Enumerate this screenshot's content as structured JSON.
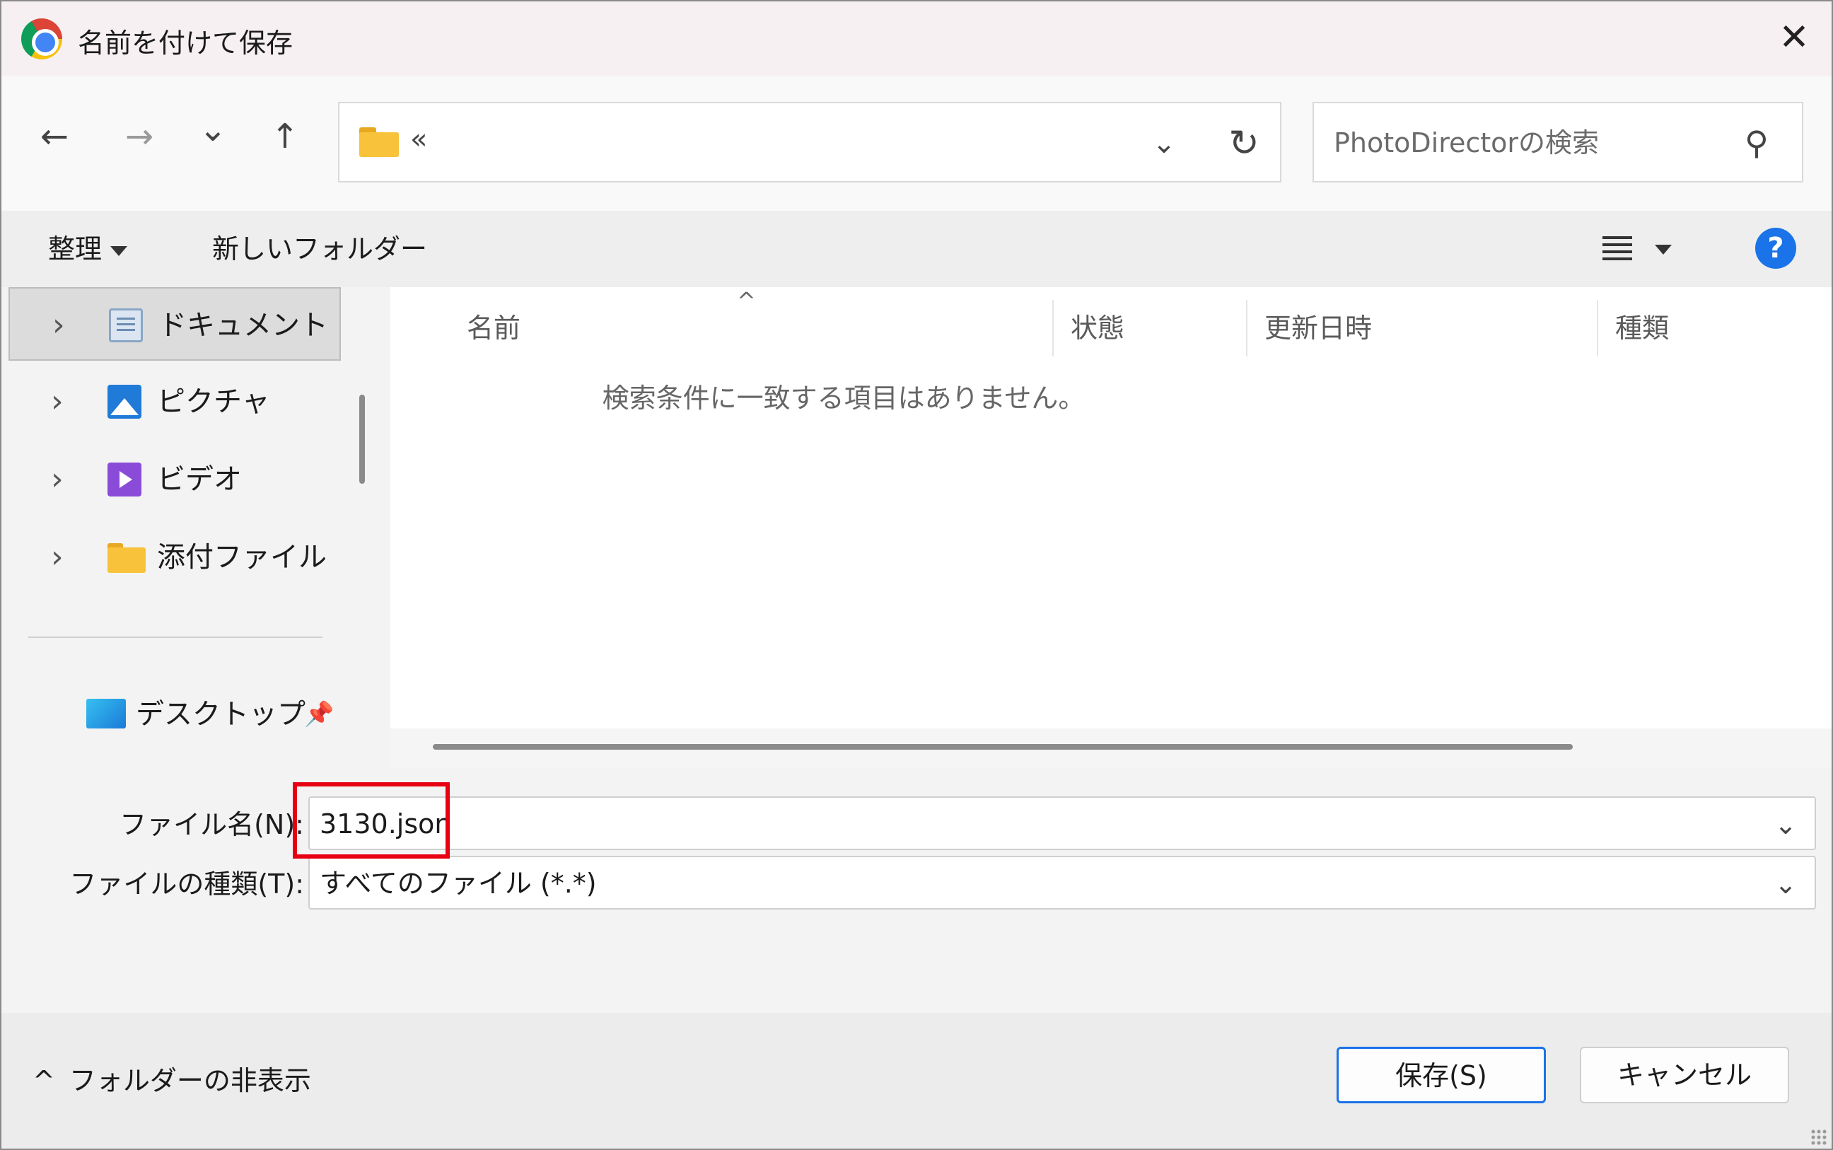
{
  "window": {
    "title": "名前を付けて保存",
    "close_glyph": "✕"
  },
  "address_bar": {
    "back_glyph": "←",
    "forward_glyph": "→",
    "recent_glyph": "⌄",
    "up_glyph": "↑",
    "breadcrumb": "«",
    "dropdown_glyph": "⌄",
    "refresh_glyph": "↻"
  },
  "search": {
    "placeholder": "PhotoDirectorの検索",
    "icon_glyph": "⚲"
  },
  "toolbar": {
    "organize_label": "整理",
    "new_folder_label": "新しいフォルダー",
    "help_label": "?"
  },
  "nav_pane": {
    "items": [
      {
        "label": "ドキュメント",
        "icon": "document-icon",
        "selected": true
      },
      {
        "label": "ピクチャ",
        "icon": "picture-icon",
        "selected": false
      },
      {
        "label": "ビデオ",
        "icon": "video-icon",
        "selected": false
      },
      {
        "label": "添付ファイル",
        "icon": "folder-icon",
        "selected": false
      }
    ],
    "pinned": [
      {
        "label": "デスクトップ",
        "icon": "desktop-icon",
        "pin_glyph": "📌"
      }
    ],
    "chevron_glyph": "›"
  },
  "file_list": {
    "columns": [
      "名前",
      "状態",
      "更新日時",
      "種類"
    ],
    "sort_glyph": "^",
    "empty_message": "検索条件に一致する項目はありません。"
  },
  "save_fields": {
    "filename_label": "ファイル名(N):",
    "filename_value": "3130.json",
    "filetype_label": "ファイルの種類(T):",
    "filetype_value": "すべてのファイル (*.*)",
    "dropdown_glyph": "⌄"
  },
  "footer": {
    "hide_folders_glyph": "^",
    "hide_folders_label": "フォルダーの非表示",
    "save_button": "保存(S)",
    "cancel_button": "キャンセル"
  },
  "colors": {
    "highlight": "#e60012",
    "accent": "#1a73e8"
  }
}
